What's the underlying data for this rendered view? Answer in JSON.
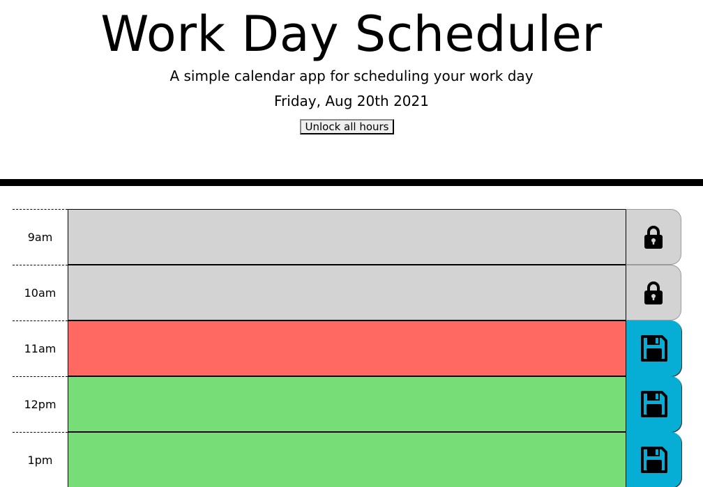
{
  "header": {
    "title": "Work Day Scheduler",
    "subtitle": "A simple calendar app for scheduling your work day",
    "date": "Friday, Aug 20th 2021",
    "unlock_label": "Unlock all hours"
  },
  "colors": {
    "past": "#d3d3d3",
    "present": "#ff6961",
    "future": "#77dd77",
    "save": "#06aed5"
  },
  "rows": [
    {
      "hour": "9am",
      "status": "past",
      "action": "lock-icon",
      "text": ""
    },
    {
      "hour": "10am",
      "status": "past",
      "action": "lock-icon",
      "text": ""
    },
    {
      "hour": "11am",
      "status": "present",
      "action": "save-icon",
      "text": ""
    },
    {
      "hour": "12pm",
      "status": "future",
      "action": "save-icon",
      "text": ""
    },
    {
      "hour": "1pm",
      "status": "future",
      "action": "save-icon",
      "text": ""
    }
  ]
}
